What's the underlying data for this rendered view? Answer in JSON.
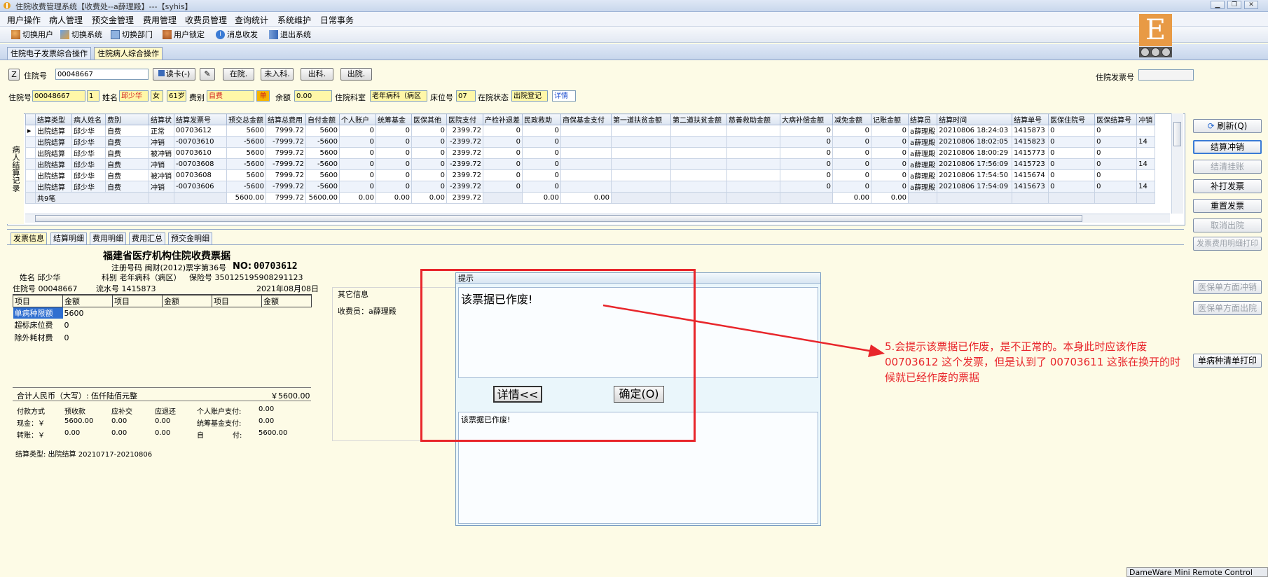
{
  "window": {
    "title": "住院收费管理系统【收费处--a薛理殿】---【syhis】"
  },
  "menu": [
    "用户操作",
    "病人管理",
    "预交金管理",
    "费用管理",
    "收费员管理",
    "查询统计",
    "系统维护",
    "日常事务"
  ],
  "toolbar": [
    "切换用户",
    "切换系统",
    "切换部门",
    "用户锁定",
    "消息收发",
    "退出系统"
  ],
  "tabs": [
    "住院电子发票综合操作",
    "住院病人综合操作"
  ],
  "logo_letter": "E",
  "topform": {
    "z_btn": "Z",
    "admission_label": "住院号",
    "admission_value": "00048667",
    "read_card": "读卡(-)",
    "btn_inhospital": "在院.",
    "btn_transfer_in": "未入科.",
    "btn_transfer_out": "出科.",
    "btn_discharge": "出院.",
    "invoice_no_label": "住院发票号",
    "invoice_no_value": ""
  },
  "patient": {
    "admission_label": "住院号",
    "admission_value": "00048667",
    "seq": "1",
    "name_label": "姓名",
    "name": "邱少华",
    "sex": "女",
    "age": "61岁",
    "fee_type_label": "费别",
    "fee_type": "自费",
    "single": "单",
    "balance_label": "余额",
    "balance": "0.00",
    "dept_label": "住院科室",
    "dept": "老年病科（病区",
    "bed_label": "床位号",
    "bed": "07",
    "status_label": "在院状态",
    "status": "出院登记",
    "detail_link": "详情"
  },
  "grid": {
    "side_label": "病人结算记录",
    "headers": [
      "结算类型",
      "病人姓名",
      "费别",
      "结算状",
      "结算发票号",
      "预交总金额",
      "结算总费用",
      "自付金额",
      "个人账户",
      "统筹基金",
      "医保其他",
      "医院支付",
      "产检补退差",
      "民政救助",
      "商保基金支付",
      "第一道扶贫金额",
      "第二道扶贫金额",
      "慈善救助金额",
      "大病补偿金额",
      "减免金额",
      "记账金额",
      "结算员",
      "结算时间",
      "结算单号",
      "医保住院号",
      "医保结算号",
      "冲销"
    ],
    "rows": [
      [
        "出院结算",
        "邱少华",
        "自费",
        "正常",
        "00703612",
        "5600",
        "7999.72",
        "5600",
        "0",
        "0",
        "0",
        "2399.72",
        "0",
        "0",
        "",
        "",
        "",
        "",
        "0",
        "0",
        "0",
        "a薛理殿",
        "20210806 18:24:03",
        "1415873",
        "0",
        "0",
        ""
      ],
      [
        "出院结算",
        "邱少华",
        "自费",
        "冲销",
        "-00703610",
        "-5600",
        "-7999.72",
        "-5600",
        "0",
        "0",
        "0",
        "-2399.72",
        "0",
        "0",
        "",
        "",
        "",
        "",
        "0",
        "0",
        "0",
        "a薛理殿",
        "20210806 18:02:05",
        "1415823",
        "0",
        "0",
        "14"
      ],
      [
        "出院结算",
        "邱少华",
        "自费",
        "被冲销",
        "00703610",
        "5600",
        "7999.72",
        "5600",
        "0",
        "0",
        "0",
        "2399.72",
        "0",
        "0",
        "",
        "",
        "",
        "",
        "0",
        "0",
        "0",
        "a薛理殿",
        "20210806 18:00:29",
        "1415773",
        "0",
        "0",
        ""
      ],
      [
        "出院结算",
        "邱少华",
        "自费",
        "冲销",
        "-00703608",
        "-5600",
        "-7999.72",
        "-5600",
        "0",
        "0",
        "0",
        "-2399.72",
        "0",
        "0",
        "",
        "",
        "",
        "",
        "0",
        "0",
        "0",
        "a薛理殿",
        "20210806 17:56:09",
        "1415723",
        "0",
        "0",
        "14"
      ],
      [
        "出院结算",
        "邱少华",
        "自费",
        "被冲销",
        "00703608",
        "5600",
        "7999.72",
        "5600",
        "0",
        "0",
        "0",
        "2399.72",
        "0",
        "0",
        "",
        "",
        "",
        "",
        "0",
        "0",
        "0",
        "a薛理殿",
        "20210806 17:54:50",
        "1415674",
        "0",
        "0",
        ""
      ],
      [
        "出院结算",
        "邱少华",
        "自费",
        "冲销",
        "-00703606",
        "-5600",
        "-7999.72",
        "-5600",
        "0",
        "0",
        "0",
        "-2399.72",
        "0",
        "0",
        "",
        "",
        "",
        "",
        "0",
        "0",
        "0",
        "a薛理殿",
        "20210806 17:54:09",
        "1415673",
        "0",
        "0",
        "14"
      ]
    ],
    "totals": {
      "count": "共9笔",
      "prepay": "5600.00",
      "total": "7999.72",
      "self": "5600.00",
      "personal": "0.00",
      "pool": "0.00",
      "other": "0.00",
      "hospital": "2399.72",
      "civil": "0.00",
      "commercial": "0.00",
      "discount": "0.00",
      "account": "0.00"
    }
  },
  "right_buttons": [
    "刷新(Q)",
    "结算冲销",
    "结清挂账",
    "补打发票",
    "重置发票",
    "取消出院",
    "发票费用明细打印",
    "医保单方面冲销",
    "医保单方面出院",
    "单病种清单打印"
  ],
  "subtabs": [
    "发票信息",
    "结算明细",
    "费用明细",
    "费用汇总",
    "预交金明细"
  ],
  "receipt": {
    "title": "福建省医疗机构住院收费票据",
    "reg_line": "注册号码 闽财(2012)票字第36号",
    "no_label": "NO:",
    "no_value": "00703612",
    "name_line": "姓名 邱少华",
    "dept_line": "科别 老年病科（病区）",
    "insurance_line": "保险号 350125195908291123",
    "admission_line": "住院号 00048667",
    "serial_line": "流水号 1415873",
    "date_line": "2021年08月08日",
    "table_headers": [
      "项目",
      "金额",
      "项目",
      "金额",
      "项目",
      "金额"
    ],
    "items": [
      {
        "name": "单病种限额",
        "amount": "5600"
      },
      {
        "name": "超标床位费",
        "amount": "0"
      },
      {
        "name": "除外耗材费",
        "amount": "0"
      }
    ],
    "total_label": "合计人民币（大写）:",
    "total_words": "伍仟陆佰元整",
    "total_num": "￥5600.00",
    "pay_headers": [
      "付款方式",
      "预收款",
      "应补交",
      "应退还",
      "个人账户支付:",
      "0.00"
    ],
    "cash_row": [
      "现金：￥",
      "5600.00",
      "0.00",
      "0.00",
      "统筹基金支付:",
      "0.00"
    ],
    "transfer_row": [
      "转账：￥",
      "0.00",
      "0.00",
      "0.00",
      "自",
      "付:",
      "5600.00"
    ],
    "settle_type": "结算类型: 出院结算  20210717-20210806"
  },
  "other_info": {
    "title": "其它信息",
    "cashier": "收费员：a薛理殿"
  },
  "dialog": {
    "title": "提示",
    "message": "该票据已作废!",
    "detail_btn": "详情<<",
    "ok_btn": "确定(O)",
    "detail_text": "该票据已作废!"
  },
  "annotation": "5.会提示该票据已作废，是不正常的。本身此时应该作废 00703612 这个发票，但是认到了 00703611 这张在换开的时候就已经作废的票据",
  "remote_label": "DameWare Mini Remote Control"
}
